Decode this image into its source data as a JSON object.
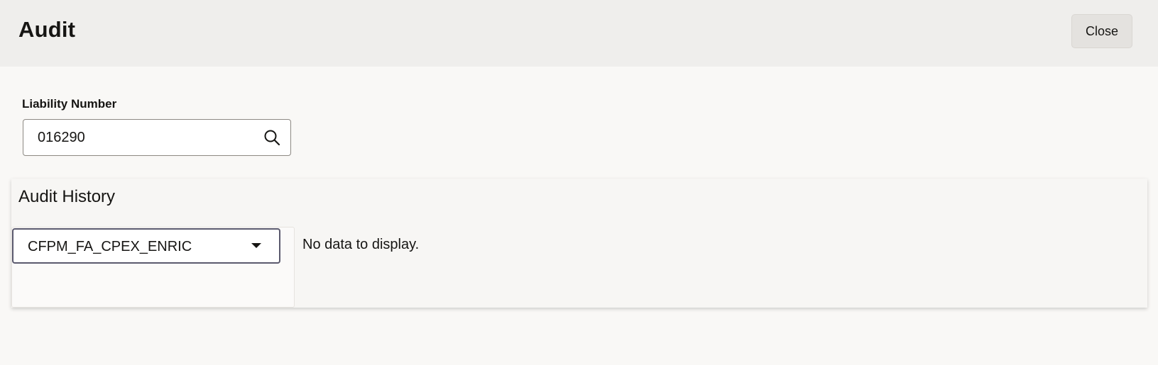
{
  "header": {
    "title": "Audit",
    "close_label": "Close"
  },
  "form": {
    "liability_label": "Liability Number",
    "liability_value": "016290",
    "search_icon": "search-icon"
  },
  "audit_history": {
    "title": "Audit History",
    "selected_version": "CFPM_FA_CPEX_ENRIC",
    "dropdown_icon": "chevron-down-icon",
    "empty_message": "No data to display."
  }
}
